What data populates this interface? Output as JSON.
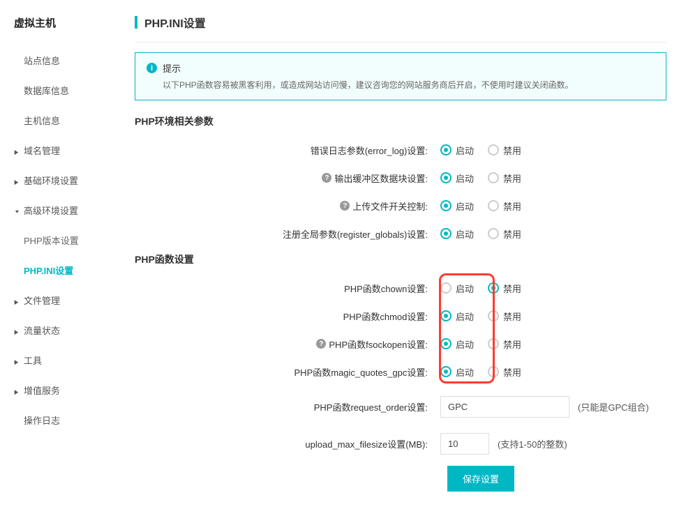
{
  "sidebar": {
    "title": "虚拟主机",
    "items": [
      {
        "label": "站点信息",
        "lvl": 1,
        "arrow": false
      },
      {
        "label": "数据库信息",
        "lvl": 1,
        "arrow": false
      },
      {
        "label": "主机信息",
        "lvl": 1,
        "arrow": false
      },
      {
        "label": "域名管理",
        "lvl": 1,
        "arrow": true
      },
      {
        "label": "基础环境设置",
        "lvl": 1,
        "arrow": true
      },
      {
        "label": "高级环境设置",
        "lvl": 1,
        "arrow": true,
        "expanded": true
      },
      {
        "label": "PHP版本设置",
        "lvl": 2
      },
      {
        "label": "PHP.INI设置",
        "lvl": 2,
        "active": true
      },
      {
        "label": "文件管理",
        "lvl": 1,
        "arrow": true
      },
      {
        "label": "流量状态",
        "lvl": 1,
        "arrow": true
      },
      {
        "label": "工具",
        "lvl": 1,
        "arrow": true
      },
      {
        "label": "增值服务",
        "lvl": 1,
        "arrow": true
      },
      {
        "label": "操作日志",
        "lvl": 1,
        "arrow": false
      }
    ]
  },
  "page": {
    "title": "PHP.INI设置",
    "alert_title": "提示",
    "alert_body": "以下PHP函数容易被黑客利用，或造成网站访问慢，建议咨询您的网站服务商后开启，不使用时建议关闭函数。",
    "section_env": "PHP环境相关参数",
    "section_func": "PHP函数设置",
    "labels": {
      "enable": "启动",
      "disable": "禁用"
    },
    "env_rows": [
      {
        "label": "错误日志参数(error_log)设置:",
        "help": false,
        "value": "on"
      },
      {
        "label": "输出缓冲区数据块设置:",
        "help": true,
        "value": "on"
      },
      {
        "label": "上传文件开关控制:",
        "help": true,
        "value": "on"
      },
      {
        "label": "注册全局参数(register_globals)设置:",
        "help": false,
        "value": "on"
      }
    ],
    "func_rows": [
      {
        "label": "PHP函数chown设置:",
        "help": false,
        "value": "off"
      },
      {
        "label": "PHP函数chmod设置:",
        "help": false,
        "value": "on"
      },
      {
        "label": "PHP函数fsockopen设置:",
        "help": true,
        "value": "on"
      },
      {
        "label": "PHP函数magic_quotes_gpc设置:",
        "help": false,
        "value": "on"
      }
    ],
    "request_order": {
      "label": "PHP函数request_order设置:",
      "value": "GPC",
      "hint": "(只能是GPC组合)"
    },
    "upload_max": {
      "label": "upload_max_filesize设置(MB):",
      "value": "10",
      "hint": "(支持1-50的整数)"
    },
    "save_btn": "保存设置"
  }
}
